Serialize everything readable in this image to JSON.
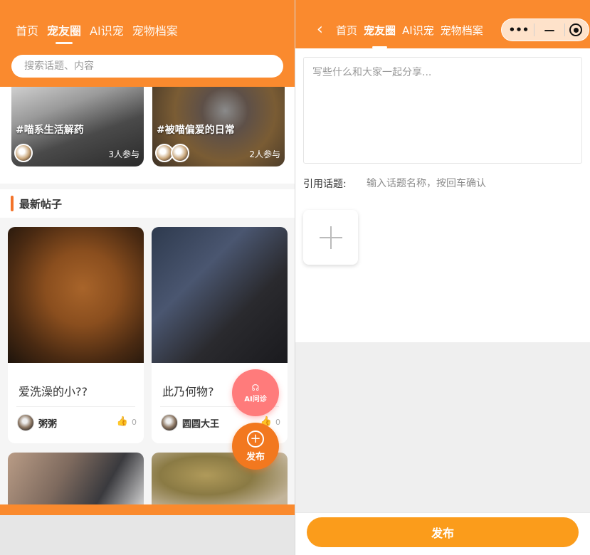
{
  "left": {
    "nav": [
      "首页",
      "宠友圈",
      "AI识宠",
      "宠物档案"
    ],
    "active_nav": "宠友圈",
    "search_placeholder": "搜索话题、内容",
    "topics": [
      {
        "title": "#喵系生活解药",
        "count": "3人参与"
      },
      {
        "title": "#被喵偏爱的日常",
        "count": "2人参与"
      }
    ],
    "section_title": "最新帖子",
    "posts": [
      {
        "title": "爱洗澡的小??",
        "author": "粥粥",
        "likes": "0"
      },
      {
        "title": "此乃何物?",
        "author": "圆圆大王",
        "likes": "0"
      }
    ],
    "fab_ai": "AI问诊",
    "fab_publish": "发布"
  },
  "right": {
    "nav": [
      "首页",
      "宠友圈",
      "AI识宠",
      "宠物档案"
    ],
    "active_nav": "宠友圈",
    "capsule": {
      "more": "•••",
      "min": "—"
    },
    "content_placeholder": "写些什么和大家一起分享...",
    "cite_label": "引用话题:",
    "cite_placeholder": "输入话题名称，按回车确认",
    "publish": "发布"
  },
  "colors": {
    "brand": "#fa8a2e",
    "button": "#fb9c1b",
    "ai": "#ff7b7b"
  }
}
